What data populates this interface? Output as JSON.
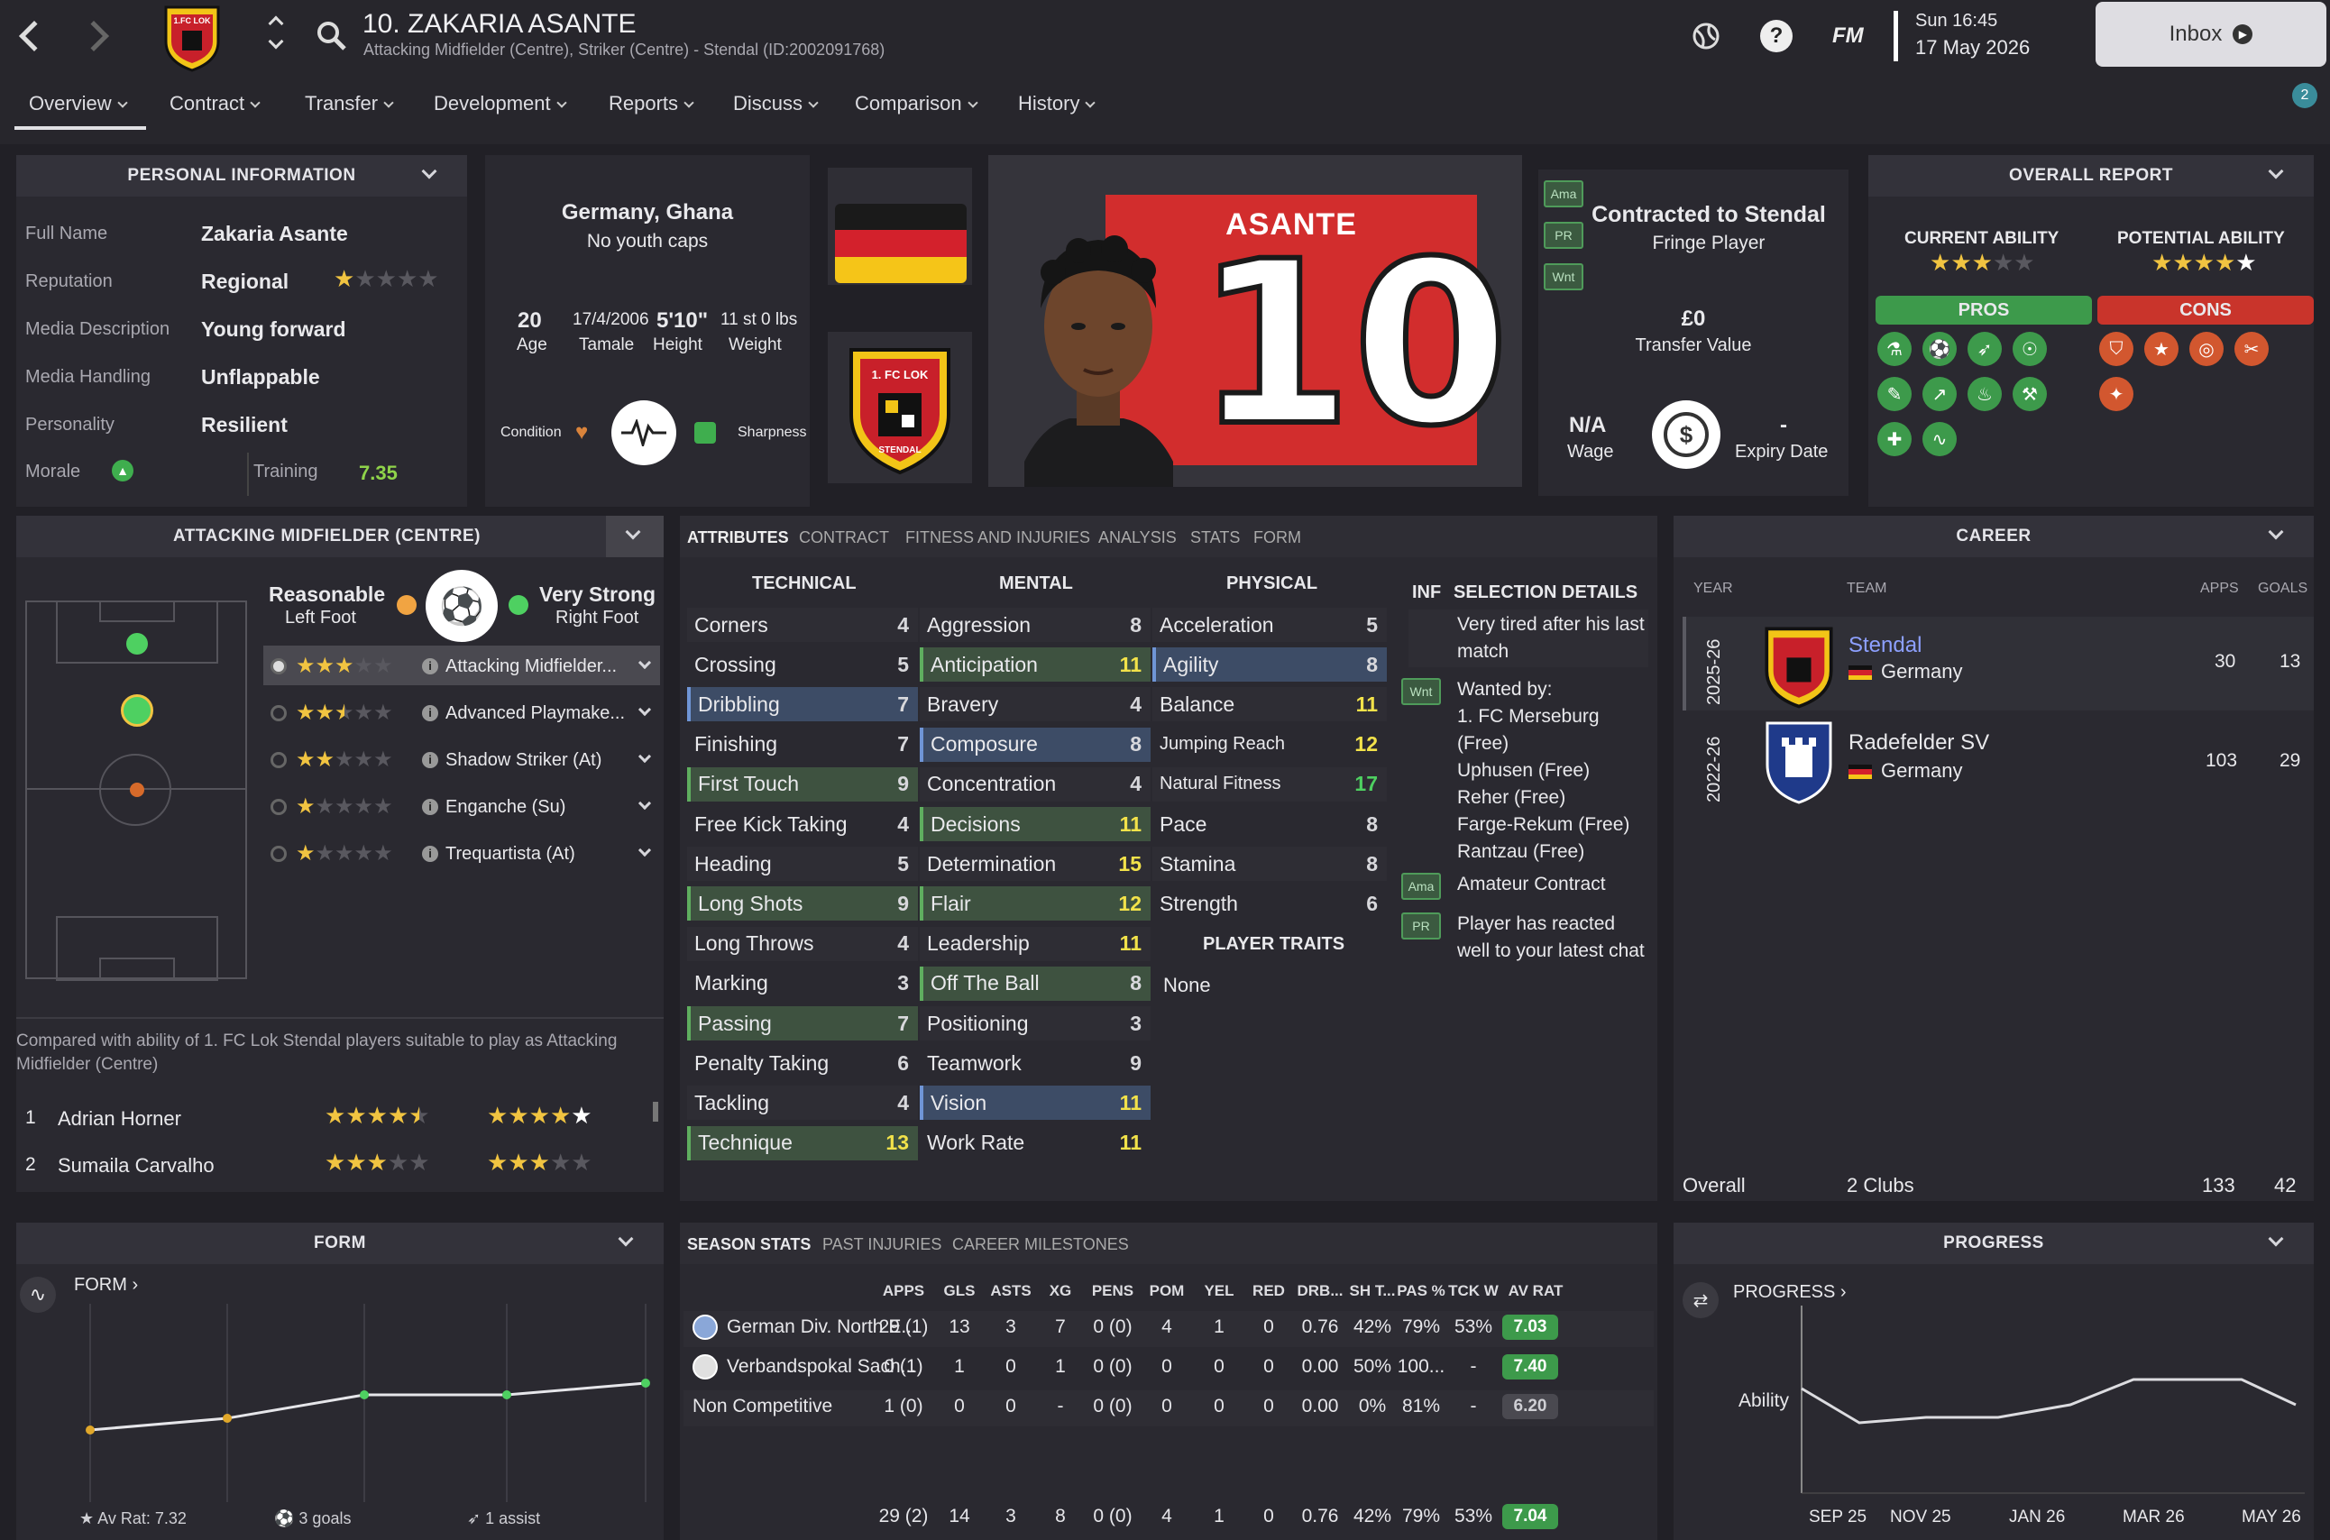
{
  "header": {
    "title": "10. ZAKARIA ASANTE",
    "subtitle": "Attacking Midfielder (Centre), Striker (Centre) - Stendal (ID:2002091768)",
    "time": "Sun 16:45",
    "date": "17 May 2026",
    "inbox": "Inbox",
    "fm": "FM",
    "notif_count": "2"
  },
  "tabs": [
    {
      "label": "Overview"
    },
    {
      "label": "Contract"
    },
    {
      "label": "Transfer"
    },
    {
      "label": "Development"
    },
    {
      "label": "Reports"
    },
    {
      "label": "Discuss"
    },
    {
      "label": "Comparison"
    },
    {
      "label": "History"
    }
  ],
  "personal": {
    "title": "PERSONAL INFORMATION",
    "rows": [
      {
        "label": "Full Name",
        "value": "Zakaria Asante"
      },
      {
        "label": "Reputation",
        "value": "Regional"
      },
      {
        "label": "Media Description",
        "value": "Young forward"
      },
      {
        "label": "Media Handling",
        "value": "Unflappable"
      },
      {
        "label": "Personality",
        "value": "Resilient"
      }
    ],
    "morale_label": "Morale",
    "training_label": "Training",
    "training_value": "7.35",
    "reputation_stars": 1
  },
  "bio": {
    "nationality": "Germany, Ghana",
    "caps": "No youth caps",
    "age": "20",
    "age_label": "Age",
    "dob": "17/4/2006",
    "birthplace": "Tamale",
    "height": "5'10\"",
    "height_label": "Height",
    "weight": "11 st 0 lbs",
    "weight_label": "Weight",
    "condition": "Condition",
    "sharpness": "Sharpness"
  },
  "shirt": {
    "name": "ASANTE",
    "number": "10"
  },
  "club_badge": {
    "text": "1. FC LOK",
    "sub": "STENDAL"
  },
  "contract": {
    "title": "Contracted to Stendal",
    "status": "Fringe Player",
    "value": "£0",
    "value_label": "Transfer Value",
    "wage": "N/A",
    "wage_label": "Wage",
    "expiry": "-",
    "expiry_label": "Expiry Date",
    "tags": [
      "Ama",
      "PR",
      "Wnt"
    ]
  },
  "report": {
    "title": "OVERALL REPORT",
    "ca_label": "CURRENT ABILITY",
    "pa_label": "POTENTIAL ABILITY",
    "ca_stars": 3,
    "pa_stars": 5,
    "pros": "PROS",
    "cons": "CONS"
  },
  "position": {
    "title": "ATTACKING MIDFIELDER (CENTRE)",
    "left_foot": "Reasonable",
    "left_foot_label": "Left Foot",
    "right_foot": "Very Strong",
    "right_foot_label": "Right Foot",
    "roles": [
      {
        "name": "Attacking Midfielder...",
        "stars": 3
      },
      {
        "name": "Advanced Playmake...",
        "stars": 2.5
      },
      {
        "name": "Shadow Striker (At)",
        "stars": 2
      },
      {
        "name": "Enganche (Su)",
        "stars": 1
      },
      {
        "name": "Trequartista (At)",
        "stars": 1
      }
    ],
    "compare_text": "Compared with ability of 1. FC Lok Stendal players suitable to play as Attacking Midfielder (Centre)",
    "compare": [
      {
        "rank": "1",
        "name": "Adrian Horner",
        "ca": 4.5,
        "pa": 5
      },
      {
        "rank": "2",
        "name": "Sumaila Carvalho",
        "ca": 3,
        "pa": 3
      }
    ]
  },
  "attr_tabs": [
    "ATTRIBUTES",
    "CONTRACT",
    "FITNESS AND INJURIES",
    "ANALYSIS",
    "STATS",
    "FORM"
  ],
  "technical": {
    "title": "TECHNICAL",
    "items": [
      [
        "Corners",
        "4"
      ],
      [
        "Crossing",
        "5"
      ],
      [
        "Dribbling",
        "7"
      ],
      [
        "Finishing",
        "7"
      ],
      [
        "First Touch",
        "9"
      ],
      [
        "Free Kick Taking",
        "4"
      ],
      [
        "Heading",
        "5"
      ],
      [
        "Long Shots",
        "9"
      ],
      [
        "Long Throws",
        "4"
      ],
      [
        "Marking",
        "3"
      ],
      [
        "Passing",
        "7"
      ],
      [
        "Penalty Taking",
        "6"
      ],
      [
        "Tackling",
        "4"
      ],
      [
        "Technique",
        "13"
      ]
    ]
  },
  "mental": {
    "title": "MENTAL",
    "items": [
      [
        "Aggression",
        "8"
      ],
      [
        "Anticipation",
        "11"
      ],
      [
        "Bravery",
        "4"
      ],
      [
        "Composure",
        "8"
      ],
      [
        "Concentration",
        "4"
      ],
      [
        "Decisions",
        "11"
      ],
      [
        "Determination",
        "15"
      ],
      [
        "Flair",
        "12"
      ],
      [
        "Leadership",
        "11"
      ],
      [
        "Off The Ball",
        "8"
      ],
      [
        "Positioning",
        "3"
      ],
      [
        "Teamwork",
        "9"
      ],
      [
        "Vision",
        "11"
      ],
      [
        "Work Rate",
        "11"
      ]
    ]
  },
  "physical": {
    "title": "PHYSICAL",
    "items": [
      [
        "Acceleration",
        "5"
      ],
      [
        "Agility",
        "8"
      ],
      [
        "Balance",
        "11"
      ],
      [
        "Jumping Reach",
        "12"
      ],
      [
        "Natural Fitness",
        "17"
      ],
      [
        "Pace",
        "8"
      ],
      [
        "Stamina",
        "8"
      ],
      [
        "Strength",
        "6"
      ]
    ]
  },
  "traits": {
    "title": "PLAYER TRAITS",
    "value": "None"
  },
  "selection": {
    "inf": "INF",
    "title": "SELECTION DETAILS",
    "tired": "Very tired after his last match",
    "wanted_title": "Wanted by:",
    "wanted": [
      "1. FC Merseburg (Free)",
      "Uphusen (Free)",
      "Reher (Free)",
      "Farge-Rekum (Free)",
      "Rantzau (Free)"
    ],
    "amateur": "Amateur Contract",
    "pr_text": "Player has reacted well to your latest chat",
    "wnt": "Wnt",
    "ama": "Ama",
    "pr": "PR"
  },
  "career": {
    "title": "CAREER",
    "cols": [
      "YEAR",
      "TEAM",
      "APPS",
      "GOALS"
    ],
    "rows": [
      {
        "year": "2025-26",
        "team": "Stendal",
        "nation": "Germany",
        "apps": "30",
        "goals": "13"
      },
      {
        "year": "2022-26",
        "team": "Radefelder SV",
        "nation": "Germany",
        "apps": "103",
        "goals": "29"
      }
    ],
    "overall": "Overall",
    "clubs": "2 Clubs",
    "apps_total": "133",
    "goals_total": "42"
  },
  "form": {
    "title": "FORM",
    "link": "FORM",
    "av_rat": "Av Rat: 7.32",
    "goals": "3 goals",
    "assist": "1 assist",
    "points": [
      7.0,
      7.1,
      7.3,
      7.3,
      7.4
    ]
  },
  "season": {
    "tabs": [
      "SEASON STATS",
      "PAST INJURIES",
      "CAREER MILESTONES"
    ],
    "cols": [
      "APPS",
      "GLS",
      "ASTS",
      "XG",
      "PENS",
      "POM",
      "YEL",
      "RED",
      "DRB...",
      "SH T...",
      "PAS %",
      "TCK W",
      "AV RAT"
    ],
    "rows": [
      {
        "comp": "German Div. North E...",
        "v": [
          "29 (1)",
          "13",
          "3",
          "7",
          "0 (0)",
          "4",
          "1",
          "0",
          "0.76",
          "42%",
          "79%",
          "53%"
        ],
        "rat": "7.03"
      },
      {
        "comp": "Verbandspokal Sach...",
        "v": [
          "0 (1)",
          "1",
          "0",
          "1",
          "0 (0)",
          "0",
          "0",
          "0",
          "0.00",
          "50%",
          "100...",
          "-"
        ],
        "rat": "7.40"
      },
      {
        "comp": "Non Competitive",
        "v": [
          "1 (0)",
          "0",
          "0",
          "-",
          "0 (0)",
          "0",
          "0",
          "0",
          "0.00",
          "0%",
          "81%",
          "-"
        ],
        "rat": "6.20"
      }
    ],
    "total": [
      "29 (2)",
      "14",
      "3",
      "8",
      "0 (0)",
      "4",
      "1",
      "0",
      "0.76",
      "42%",
      "79%",
      "53%"
    ],
    "total_rat": "7.04"
  },
  "progress": {
    "title": "PROGRESS",
    "link": "PROGRESS",
    "ylabel": "Ability",
    "xlabels": [
      "SEP 25",
      "NOV 25",
      "JAN 26",
      "MAR 26",
      "MAY 26"
    ]
  },
  "colors": {
    "bg": "#212026",
    "panel": "#2a2930",
    "green": "#3d9a4b",
    "red": "#c9342b",
    "star": "#f1c441"
  }
}
